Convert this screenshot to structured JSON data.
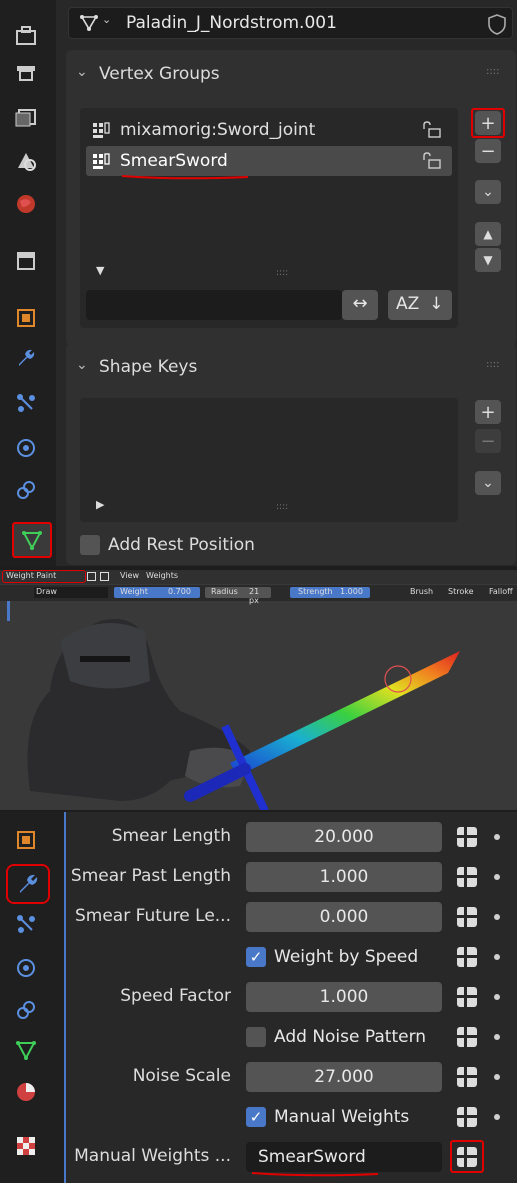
{
  "properties": {
    "object_name": "Paladin_J_Nordstrom.001",
    "vertex_groups": {
      "title": "Vertex Groups",
      "items": [
        {
          "label": "mixamorig:Sword_joint",
          "selected": false
        },
        {
          "label": "SmearSword",
          "selected": true
        }
      ],
      "filter_value": "",
      "add_symbol": "+",
      "remove_symbol": "−",
      "sort_label": "AZ",
      "drag_handle": "::::"
    },
    "shape_keys": {
      "title": "Shape Keys",
      "add_symbol": "+",
      "remove_symbol": "−",
      "drag_handle": "::::"
    },
    "add_rest_position": {
      "label": "Add Rest Position",
      "checked": false
    }
  },
  "viewport": {
    "mode": "Weight Paint",
    "menus": [
      "View",
      "Weights"
    ],
    "tool": "Draw",
    "weight": {
      "label": "Weight",
      "value": "0.700"
    },
    "radius": {
      "label": "Radius",
      "value": "21 px"
    },
    "strength": {
      "label": "Strength",
      "value": "1.000"
    },
    "dropdowns": [
      "Brush",
      "Stroke",
      "Falloff"
    ]
  },
  "modifier": {
    "rows": [
      {
        "label": "Smear Length",
        "kind": "value",
        "value": "20.000"
      },
      {
        "label": "Smear Past Length",
        "kind": "value",
        "value": "1.000"
      },
      {
        "label": "Smear Future Le...",
        "kind": "value",
        "value": "0.000"
      },
      {
        "label": "",
        "kind": "checkbox",
        "value": "Weight by Speed",
        "checked": true
      },
      {
        "label": "Speed Factor",
        "kind": "value",
        "value": "1.000"
      },
      {
        "label": "",
        "kind": "checkbox",
        "value": "Add Noise Pattern",
        "checked": false
      },
      {
        "label": "Noise Scale",
        "kind": "value",
        "value": "27.000"
      },
      {
        "label": "",
        "kind": "checkbox",
        "value": "Manual Weights",
        "checked": true
      },
      {
        "label": "Manual Weights ...",
        "kind": "field",
        "value": "SmearSword"
      }
    ]
  },
  "colors": {
    "accent": "#4a78c9",
    "highlight": "#e00000",
    "green_icon": "#3fcf59"
  }
}
